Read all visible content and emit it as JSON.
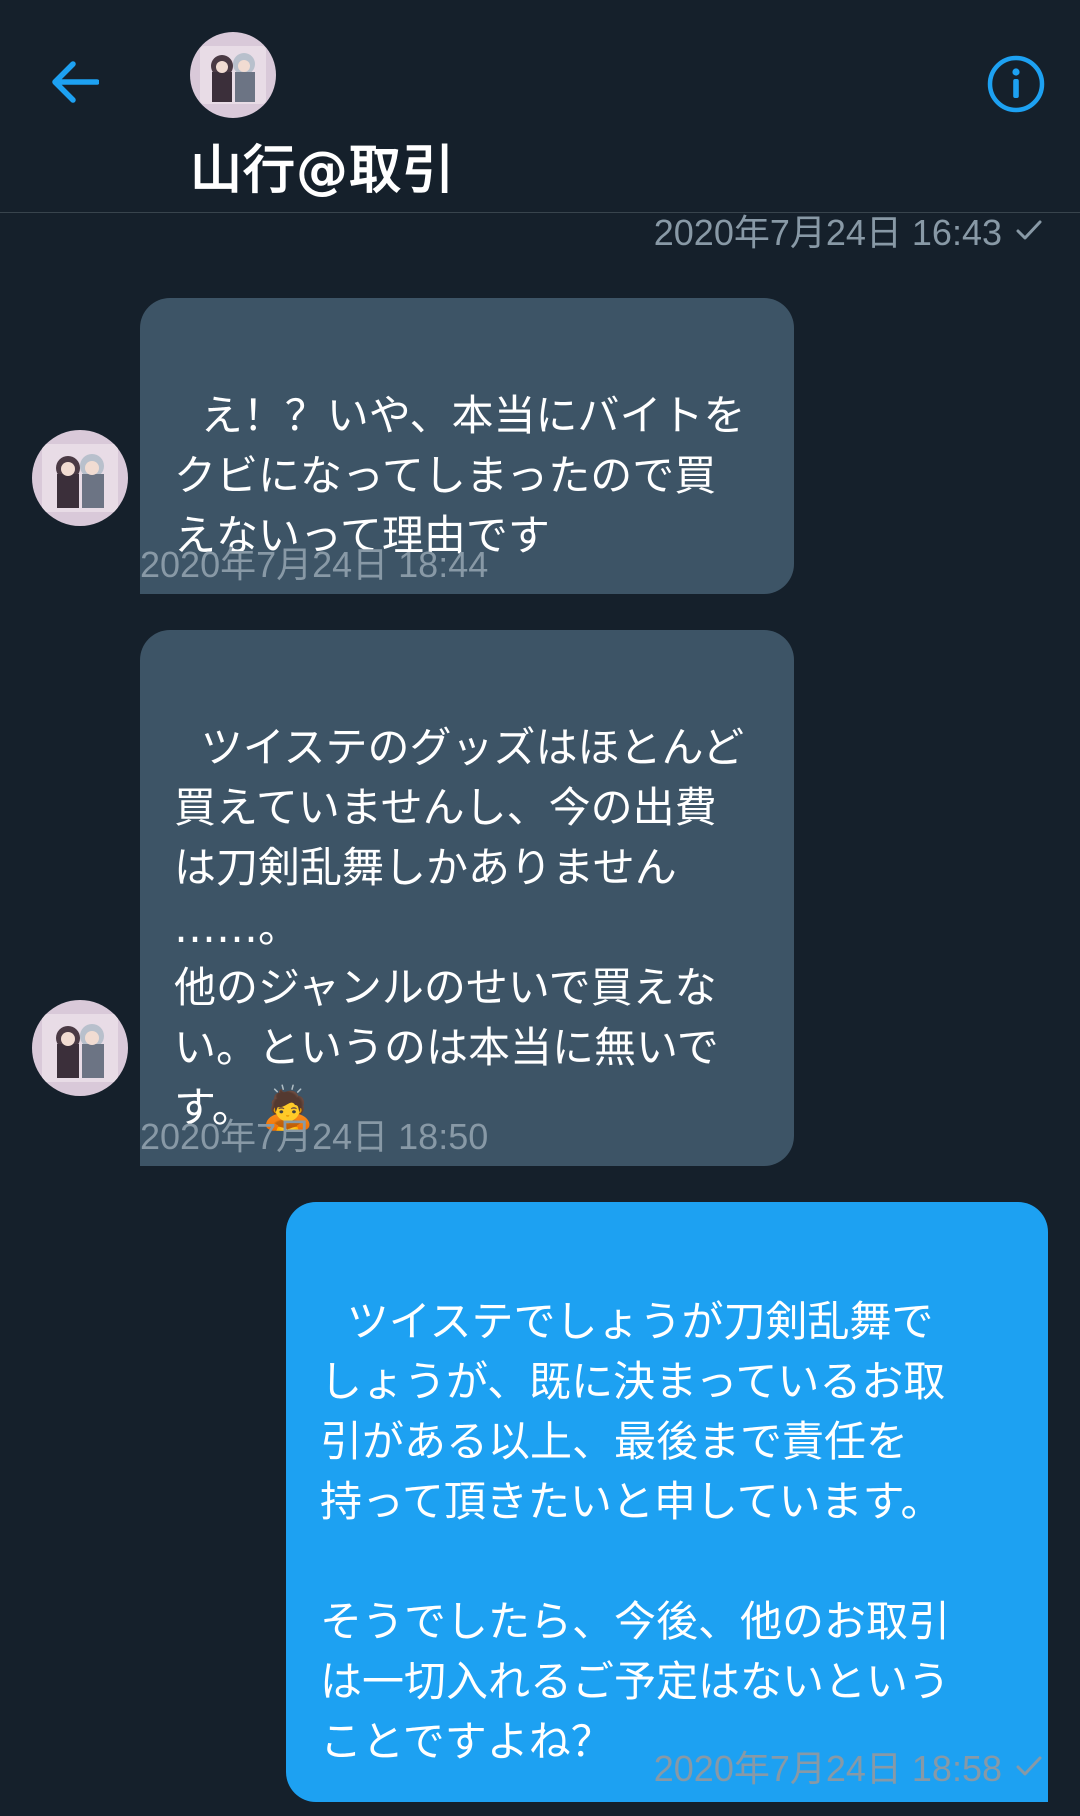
{
  "header": {
    "contact_name": "山行@取引",
    "back_icon": "arrow-left-icon",
    "info_icon": "info-icon"
  },
  "colors": {
    "background": "#15202b",
    "incoming_bubble": "#3d5466",
    "outgoing_bubble": "#1da1f2",
    "accent": "#1da1f2",
    "timestamp": "#8899a6"
  },
  "messages": [
    {
      "direction": "out",
      "timestamp": "2020年7月24日 16:43",
      "read": true
    },
    {
      "direction": "in",
      "text": "え！？いや、本当にバイトを\nクビになってしまったので買\nえないって理由です",
      "timestamp": "2020年7月24日 18:44"
    },
    {
      "direction": "in",
      "text": "ツイステのグッズはほとんど\n買えていませんし、今の出費\nは刀剣乱舞しかありません\n……。\n他のジャンルのせいで買えな\nい。というのは本当に無いで\nす。",
      "emoji": "🙇",
      "timestamp": "2020年7月24日 18:50"
    },
    {
      "direction": "out",
      "text": "ツイステでしょうが刀剣乱舞で\nしょうが、既に決まっているお取\n引がある以上、最後まで責任を\n持って頂きたいと申しています。\n\nそうでしたら、今後、他のお取引\nは一切入れるご予定はないという\nことですよね？",
      "timestamp": "2020年7月24日 18:58",
      "read": true
    }
  ]
}
